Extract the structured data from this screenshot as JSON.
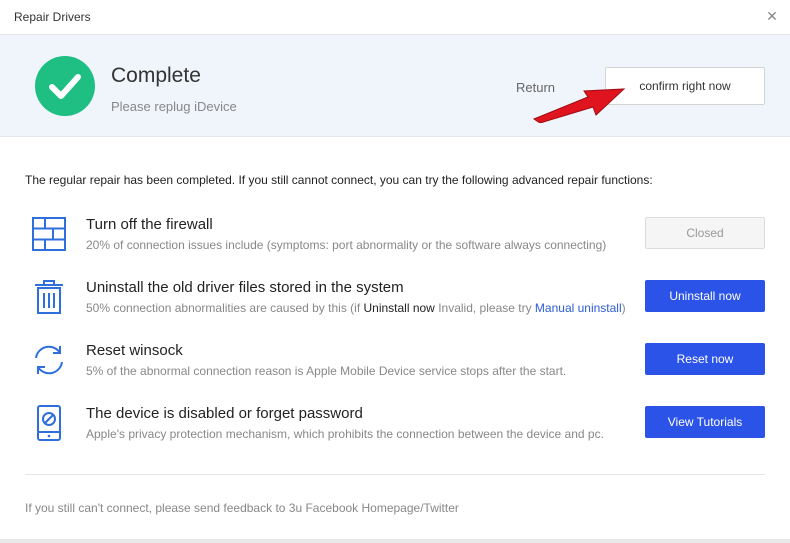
{
  "window": {
    "title": "Repair Drivers",
    "close_icon": "close-icon"
  },
  "header": {
    "status_title": "Complete",
    "status_subtitle": "Please replug iDevice",
    "return_label": "Return",
    "confirm_label": "confirm right now",
    "accent_color": "#1fbf84"
  },
  "intro_text": "The regular repair has been completed. If you still cannot connect, you can try the following advanced repair functions:",
  "items": [
    {
      "icon": "firewall-icon",
      "title": "Turn off the firewall",
      "description": "20% of connection issues include (symptoms: port abnormality or the software always connecting)",
      "button": "Closed",
      "button_state": "disabled"
    },
    {
      "icon": "trash-icon",
      "title": "Uninstall the old driver files stored in the system",
      "desc_prefix": "50% connection abnormalities are caused by this (if ",
      "desc_em": "Uninstall now",
      "desc_mid": " Invalid, please try ",
      "desc_link": "Manual uninstall",
      "desc_suffix": ")",
      "button": "Uninstall now",
      "button_state": "primary"
    },
    {
      "icon": "refresh-icon",
      "title": "Reset winsock",
      "description": "5% of the abnormal connection reason is Apple Mobile Device service stops after the start.",
      "button": "Reset now",
      "button_state": "primary"
    },
    {
      "icon": "disabled-device-icon",
      "title": "The device is disabled or forget password",
      "description": "Apple's privacy protection mechanism, which prohibits the connection between the device and pc.",
      "button": "View Tutorials",
      "button_state": "primary"
    }
  ],
  "footer_text": "If you still can't connect, please send feedback to 3u Facebook Homepage/Twitter",
  "colors": {
    "primary_button": "#2b53e8",
    "icon_blue": "#2f6fdc",
    "arrow_red": "#e0141e"
  }
}
